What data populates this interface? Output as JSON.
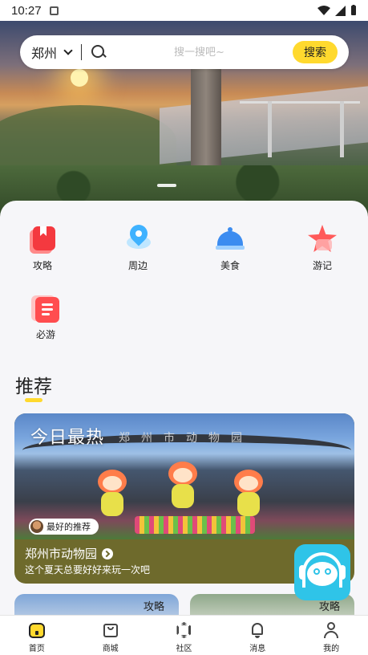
{
  "status_bar": {
    "time": "10:27",
    "notification_icon": "app-notification-icon",
    "icons": [
      "wifi-icon",
      "cellular-signal-icon",
      "battery-icon"
    ]
  },
  "hero": {
    "image": "zhengzhou-yellow-river-sunset-banner"
  },
  "search": {
    "city": "郑州",
    "placeholder": "搜一搜吧~",
    "button_label": "搜索"
  },
  "categories": [
    {
      "label": "攻略",
      "icon": "guide-bookmark-icon"
    },
    {
      "label": "周边",
      "icon": "location-pin-icon"
    },
    {
      "label": "美食",
      "icon": "food-cloche-icon"
    },
    {
      "label": "游记",
      "icon": "star-icon"
    },
    {
      "label": "必游",
      "icon": "list-document-icon"
    }
  ],
  "recommend": {
    "title": "推荐",
    "feature": {
      "overlay_title": "今日最热",
      "gate_sign": "郑州市动物园",
      "badge": "最好的推荐",
      "name": "郑州市动物园",
      "description": "这个夏天总要好好来玩一次吧"
    },
    "small_cards": [
      {
        "tag": "攻略"
      },
      {
        "tag": "攻略"
      }
    ]
  },
  "service_fab": {
    "icon": "customer-service-headset-icon"
  },
  "tabbar": [
    {
      "label": "首页",
      "icon": "home-icon",
      "active": true
    },
    {
      "label": "商城",
      "icon": "shop-icon",
      "active": false
    },
    {
      "label": "社区",
      "icon": "community-icon",
      "active": false
    },
    {
      "label": "消息",
      "icon": "bell-icon",
      "active": false
    },
    {
      "label": "我的",
      "icon": "profile-icon",
      "active": false
    }
  ],
  "colors": {
    "accent": "#ffd92e",
    "feature_footer": "#6e6a2c",
    "service": "#2fc4e8"
  }
}
